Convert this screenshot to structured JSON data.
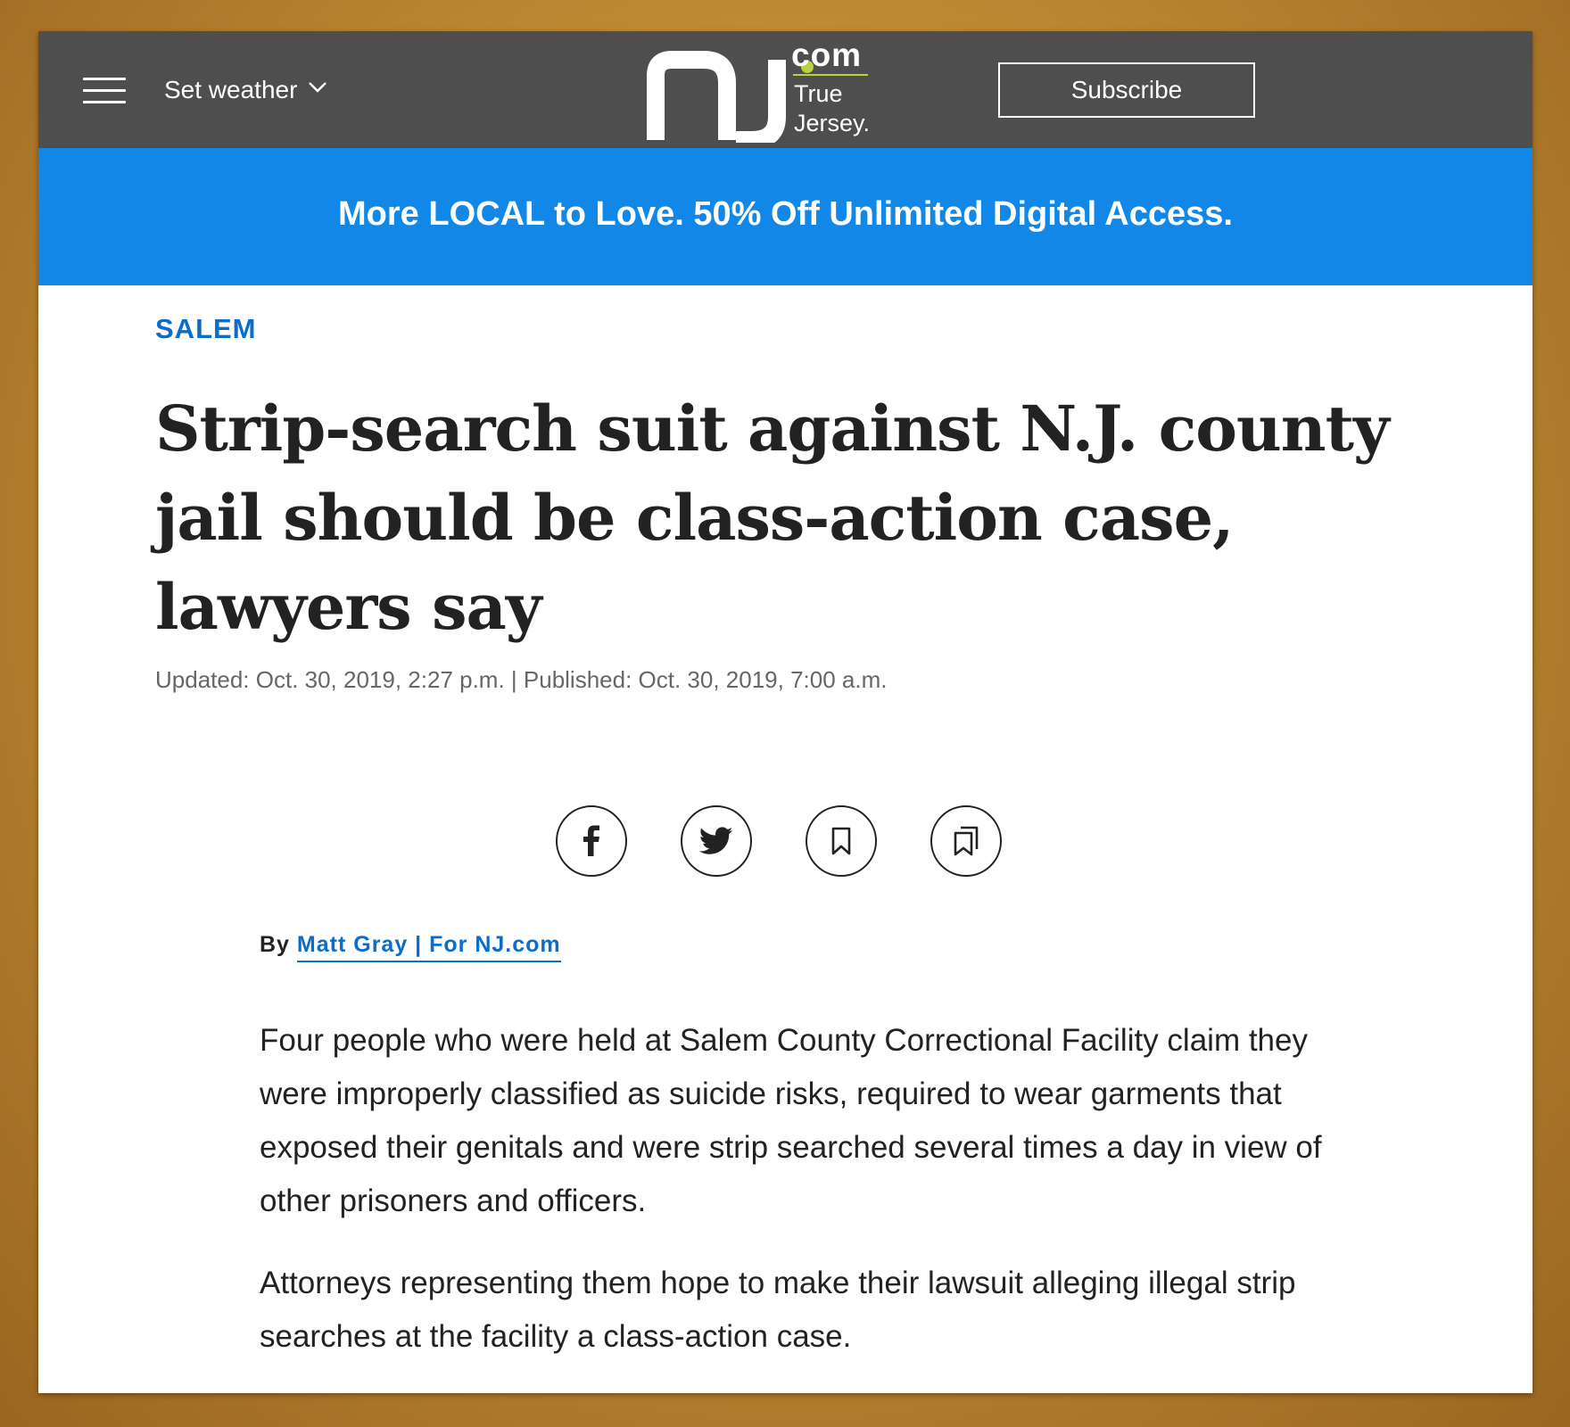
{
  "header": {
    "weather_label": "Set weather",
    "logo": {
      "letters": "nj",
      "com": "com",
      "tagline_line1": "True",
      "tagline_line2": "Jersey."
    },
    "subscribe_label": "Subscribe"
  },
  "promo": {
    "text": "More LOCAL to Love. 50% Off Unlimited Digital Access."
  },
  "article": {
    "section": "SALEM",
    "headline": "Strip-search suit against N.J. county jail should be class-action case, lawyers say",
    "dateline": "Updated: Oct. 30, 2019, 2:27 p.m. | Published: Oct. 30, 2019, 7:00 a.m.",
    "share_buttons": [
      "facebook-icon",
      "twitter-icon",
      "bookmark-icon",
      "saved-bookmarks-icon"
    ],
    "byline_prefix": "By",
    "author": "Matt Gray | For NJ.com",
    "paragraphs": [
      "Four people who were held at Salem County Correctional Facility claim they were improperly classified as suicide risks, required to wear garments that exposed their genitals and were strip searched several times a day in view of other prisoners and officers.",
      "Attorneys representing them hope to make their lawsuit alleging illegal strip searches at the facility a class-action case."
    ]
  },
  "colors": {
    "header_bg": "#4e4e4e",
    "promo_bg": "#1188e8",
    "link_blue": "#0b6cc9",
    "logo_dot": "#b9d43b"
  }
}
